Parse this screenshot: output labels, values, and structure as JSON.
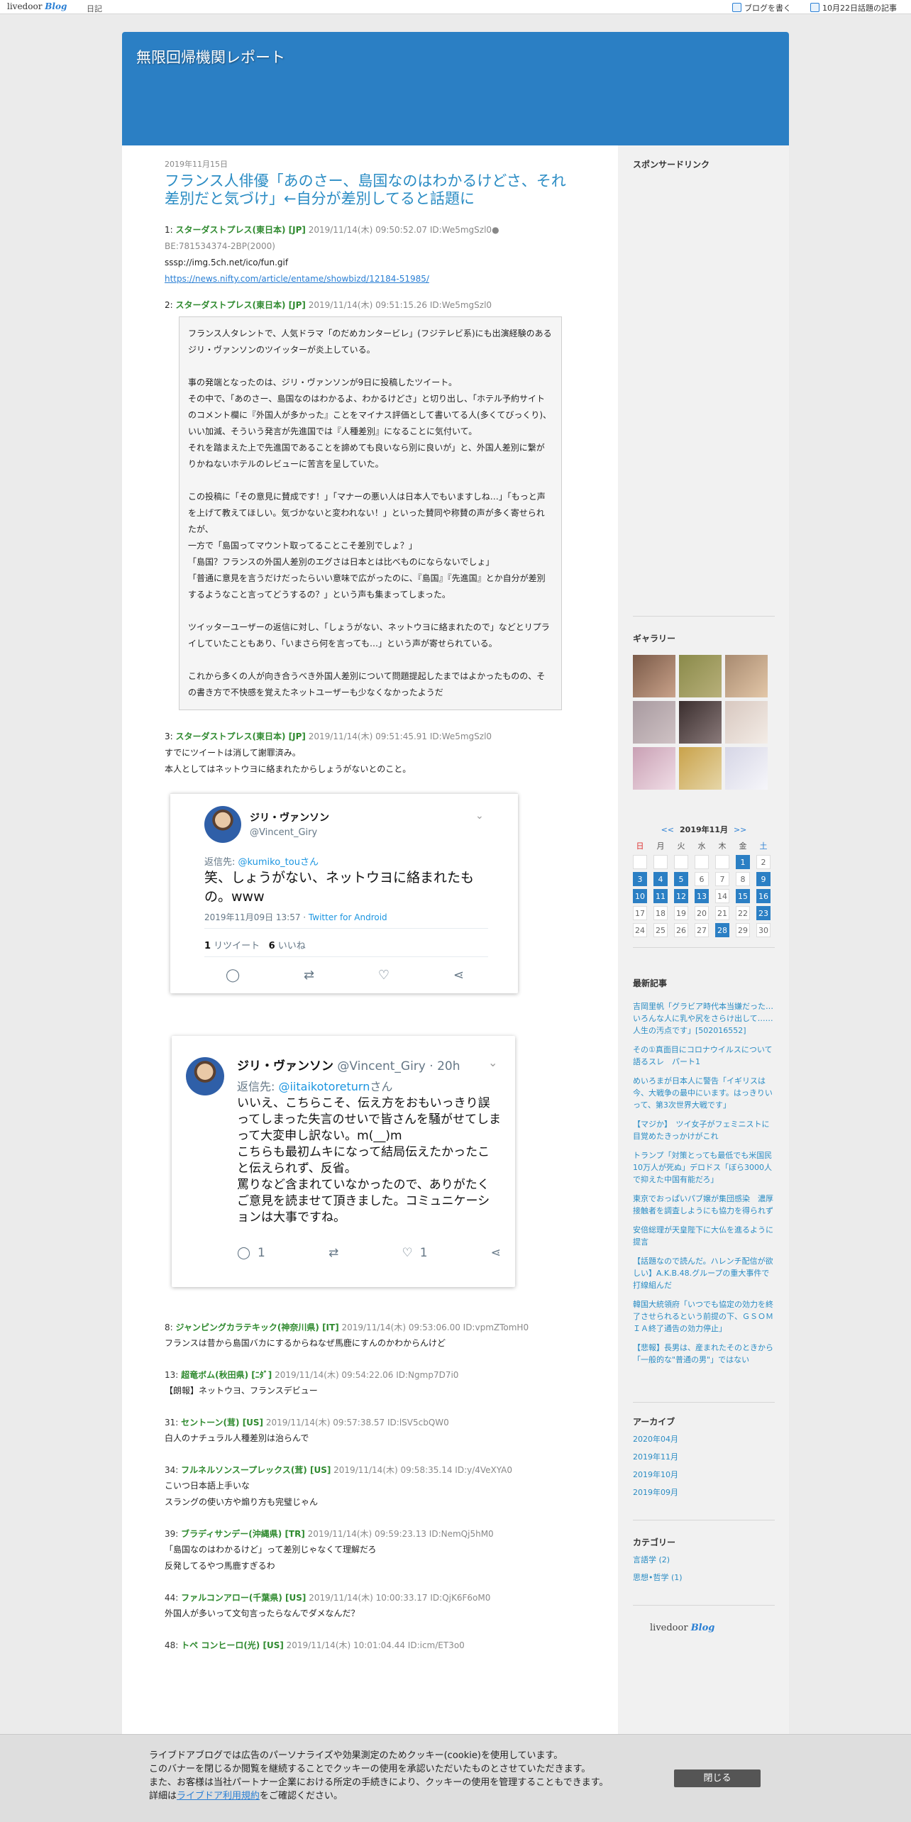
{
  "topbar": {
    "logo": "livedoor",
    "logo_blog": "Blog",
    "diary": "日記",
    "write_blog": "ブログを書く",
    "topic_date": "10月22日話題の記事"
  },
  "site_title": "無限回帰機関レポート",
  "post": {
    "date": "2019年11月15日",
    "title": "フランス人俳優「あのさー、島国なのはわかるけどさ、それ差別だと気づけ」←自分が差別してると話題に",
    "r1": {
      "num": "1:",
      "name": "スターダストプレス(東日本) [JP]",
      "meta": "2019/11/14(木) 09:50:52.07 ID:We5mgSzl0●",
      "be": "BE:781534374-2BP(2000)",
      "img": "sssp://img.5ch.net/ico/fun.gif",
      "link": "https://news.nifty.com/article/entame/showbizd/12184-51985/"
    },
    "r2": {
      "num": "2:",
      "name": "スターダストプレス(東日本) [JP]",
      "meta": "2019/11/14(木) 09:51:15.26 ID:We5mgSzl0",
      "quote": [
        "フランス人タレントで、人気ドラマ「のだめカンタービレ」(フジテレビ系)にも出演経験のあるジリ・ヴァンソンのツイッターが炎上している。",
        "事の発端となったのは、ジリ・ヴァンソンが9日に投稿したツイート。\nその中で、「あのさー、島国なのはわかるよ、わかるけどさ」と切り出し、「ホテル予約サイトのコメント欄に『外国人が多かった』ことをマイナス評価として書いてる人(多くてびっくり)、いい加減、そういう発言が先進国では『人種差別』になることに気付いて。\nそれを踏まえた上で先進国であることを諦めても良いなら別に良いが」と、外国人差別に繋がりかねないホテルのレビューに苦言を呈していた。",
        "この投稿に「その意見に賛成です！」「マナーの悪い人は日本人でもいますしね…」「もっと声を上げて教えてほしい。気づかないと変われない！」といった賛同や称賛の声が多く寄せられたが、\n一方で「島国ってマウント取ってることこそ差別でしょ？」\n「島国？フランスの外国人差別のエグさは日本とは比べものにならないでしょ」\n「普通に意見を言うだけだったらいい意味で広がったのに、『島国』『先進国』とか自分が差別するようなこと言ってどうするの？」という声も集まってしまった。",
        "ツイッターユーザーの返信に対し、「しょうがない、ネットウヨに絡まれたので」などとリプライしていたこともあり、「いまさら何を言っても…」という声が寄せられている。",
        "これから多くの人が向き合うべき外国人差別について問題提起したまではよかったものの、その書き方で不快感を覚えたネットユーザーも少なくなかったようだ"
      ]
    },
    "r3": {
      "num": "3:",
      "name": "スターダストプレス(東日本) [JP]",
      "meta": "2019/11/14(木) 09:51:45.91 ID:We5mgSzl0",
      "body": "すでにツイートは消して謝罪済み。\n本人としてはネットウヨに絡まれたからしょうがないとのこと。"
    },
    "tweet1": {
      "name": "ジリ・ヴァンソン",
      "handle": "@Vincent_Giry",
      "reply_prefix": "返信先: ",
      "reply_to": "@kumiko_touさん",
      "text": "笑、しょうがない、ネットウヨに絡まれたもの。www",
      "time": "2019年11月09日 13:57 · ",
      "client": "Twitter for Android",
      "retweets_num": "1",
      "retweets_label": " リツイート",
      "likes_num": "6",
      "likes_label": " いいね"
    },
    "tweet2": {
      "name": "ジリ・ヴァンソン",
      "handle": "@Vincent_Giry · 20h",
      "reply_prefix": "返信先: ",
      "reply_to": "@iitaikotoreturn",
      "reply_suffix": "さん",
      "text": "いいえ、こちらこそ、伝え方をおもいっきり誤ってしまった失言のせいで皆さんを騒がせてしまって大変申し訳ない。m(__)m\nこちらも最初ムキになって結局伝えたかったこと伝えられず、反省。\n罵りなど含まれていなかったので、ありがたくご意見を読ませて頂きました。コミュニケーションは大事ですね。",
      "replies": "1",
      "likes": "1"
    },
    "comments": [
      {
        "num": "8:",
        "name": "ジャンピングカラテキック(神奈川県) [IT]",
        "meta": "2019/11/14(木) 09:53:06.00 ID:vpmZTomH0",
        "body": "フランスは昔から島国バカにするからねなぜ馬鹿にすんのかわからんけど"
      },
      {
        "num": "13:",
        "name": "超竜ボム(秋田県) [ﾆﾀﾞ]",
        "meta": "2019/11/14(木) 09:54:22.06 ID:Ngmp7D7i0",
        "body": "【朗報】ネットウヨ、フランスデビュー"
      },
      {
        "num": "31:",
        "name": "セントーン(茸) [US]",
        "meta": "2019/11/14(木) 09:57:38.57 ID:lSV5cbQW0",
        "body": "白人のナチュラル人種差別は治らんで"
      },
      {
        "num": "34:",
        "name": "フルネルソンスープレックス(茸) [US]",
        "meta": "2019/11/14(木) 09:58:35.14 ID:y/4VeXYA0",
        "body": "こいつ日本語上手いな\nスラングの使い方や煽り方も完璧じゃん"
      },
      {
        "num": "39:",
        "name": "ブラディサンデー(沖縄県) [TR]",
        "meta": "2019/11/14(木) 09:59:23.13 ID:NemQj5hM0",
        "body": "「島国なのはわかるけど」って差別じゃなくて理解だろ\n反発してるやつ馬鹿すぎるわ"
      },
      {
        "num": "44:",
        "name": "ファルコンアロー(千葉県) [US]",
        "meta": "2019/11/14(木) 10:00:33.17 ID:QjK6F6oM0",
        "body": "外国人が多いって文句言ったらなんでダメなんだ？"
      },
      {
        "num": "48:",
        "name": "トペ コンヒーロ(光) [US]",
        "meta": "2019/11/14(木) 10:01:04.44 ID:icm/ET3o0",
        "body": ""
      }
    ]
  },
  "sidebar": {
    "sponsored": "スポンサードリンク",
    "gallery": "ギャラリー",
    "gallery_colors": [
      "#c9a28a",
      "#b8b07a",
      "#e3c7a8",
      "#cfc2c4",
      "#5b4b4a",
      "#e8ddd6",
      "#d7b4c4",
      "#c9a24a",
      "#e6e6ee"
    ],
    "calendar": {
      "prev": "<<",
      "title": "2019年11月",
      "next": ">>",
      "weekdays": [
        "日",
        "月",
        "火",
        "水",
        "木",
        "金",
        "土"
      ],
      "days": [
        "",
        "",
        "",
        "",
        "",
        "1",
        "2",
        "3",
        "4",
        "5",
        "6",
        "7",
        "8",
        "9",
        "10",
        "11",
        "12",
        "13",
        "14",
        "15",
        "16",
        "17",
        "18",
        "19",
        "20",
        "21",
        "22",
        "23",
        "24",
        "25",
        "26",
        "27",
        "28",
        "29",
        "30"
      ]
    },
    "recent_title": "最新記事",
    "recent": [
      "吉岡里帆「グラビア時代本当嫌だった…いろんな人に乳や尻をさらけ出して……人生の汚点です」[502016552]",
      "その①真面目にコロナウイルスについて語るスレ　パート1",
      "めいろまが日本人に警告「イギリスは今、大戦争の最中にいます。はっきりいって、第3次世界大戦です」",
      "【マジか】　ツイ女子がフェミニストに目覚めたきっかけがこれ",
      "トランプ「対策とっても最低でも米国民10万人が死ぬ」デロドス「ぼら3000人で抑えた中国有能だろ」",
      "東京でおっぱいパブ嬢が集団感染　濃厚接触者を調査しようにも協力を得られず",
      "安倍総理が天皇陛下に大仏を進るように提言",
      "【話題なので読んだ。ハレンチ配信が欲しい】A.K.B.48.グループの重大事件で打線組んだ",
      "韓国大統領府「いつでも協定の効力を終了させられるという前提の下、ＧＳＯＭＩＡ終了通告の効力停止」",
      "【悲報】長男は、産まれたそのときから「一般的な\"普通の男\"」ではない"
    ],
    "archive_title": "アーカイブ",
    "archives": [
      "2020年04月",
      "2019年11月",
      "2019年10月",
      "2019年09月"
    ],
    "category_title": "カテゴリー",
    "categories": [
      "言語学 (2)",
      "思想•哲学 (1)"
    ],
    "logo": "livedoor",
    "logo_blog": "Blog"
  },
  "cookie": {
    "line1": "ライブドアブログでは広告のパーソナライズや効果測定のためクッキー(cookie)を使用しています。",
    "line2": "このバナーを閉じるか閲覧を継続することでクッキーの使用を承認いただいたものとさせていただきます。",
    "line3": "また、お客様は当社パートナー企業における所定の手続きにより、クッキーの使用を管理することもできます。",
    "line4_pre": "詳細は",
    "line4_link": "ライブドア利用規約",
    "line4_post": "をご確認ください。",
    "close": "閉じる"
  }
}
